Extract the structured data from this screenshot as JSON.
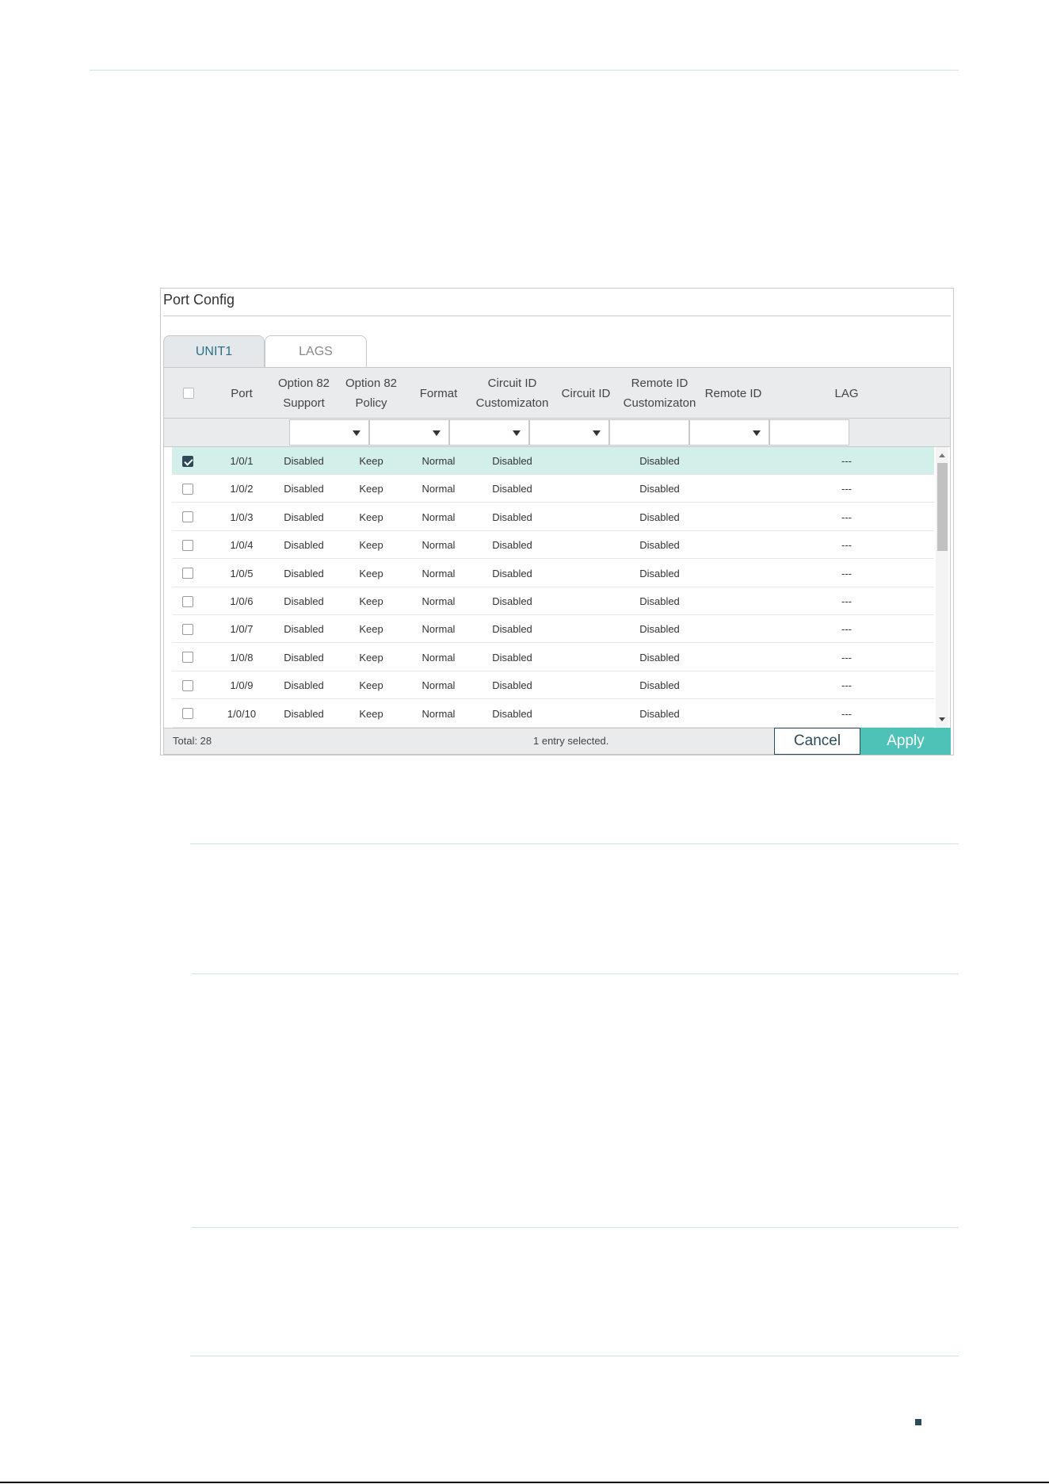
{
  "panel": {
    "title": "Port Config",
    "tabs": [
      {
        "label": "UNIT1",
        "active": true
      },
      {
        "label": "LAGS",
        "active": false
      }
    ]
  },
  "table": {
    "headers": {
      "port": "Port",
      "option82_support": "Option 82\nSupport",
      "option82_policy": "Option 82\nPolicy",
      "format": "Format",
      "circuit_id_custom": "Circuit ID\nCustomizaton",
      "circuit_id": "Circuit ID",
      "remote_id_custom": "Remote ID\nCustomizaton",
      "remote_id": "Remote ID",
      "lag": "LAG"
    },
    "rows": [
      {
        "selected": true,
        "port": "1/0/1",
        "support": "Disabled",
        "policy": "Keep",
        "format": "Normal",
        "circuit_custom": "Disabled",
        "circuit_id": "",
        "remote_custom": "Disabled",
        "remote_id": "",
        "lag": "---"
      },
      {
        "selected": false,
        "port": "1/0/2",
        "support": "Disabled",
        "policy": "Keep",
        "format": "Normal",
        "circuit_custom": "Disabled",
        "circuit_id": "",
        "remote_custom": "Disabled",
        "remote_id": "",
        "lag": "---"
      },
      {
        "selected": false,
        "port": "1/0/3",
        "support": "Disabled",
        "policy": "Keep",
        "format": "Normal",
        "circuit_custom": "Disabled",
        "circuit_id": "",
        "remote_custom": "Disabled",
        "remote_id": "",
        "lag": "---"
      },
      {
        "selected": false,
        "port": "1/0/4",
        "support": "Disabled",
        "policy": "Keep",
        "format": "Normal",
        "circuit_custom": "Disabled",
        "circuit_id": "",
        "remote_custom": "Disabled",
        "remote_id": "",
        "lag": "---"
      },
      {
        "selected": false,
        "port": "1/0/5",
        "support": "Disabled",
        "policy": "Keep",
        "format": "Normal",
        "circuit_custom": "Disabled",
        "circuit_id": "",
        "remote_custom": "Disabled",
        "remote_id": "",
        "lag": "---"
      },
      {
        "selected": false,
        "port": "1/0/6",
        "support": "Disabled",
        "policy": "Keep",
        "format": "Normal",
        "circuit_custom": "Disabled",
        "circuit_id": "",
        "remote_custom": "Disabled",
        "remote_id": "",
        "lag": "---"
      },
      {
        "selected": false,
        "port": "1/0/7",
        "support": "Disabled",
        "policy": "Keep",
        "format": "Normal",
        "circuit_custom": "Disabled",
        "circuit_id": "",
        "remote_custom": "Disabled",
        "remote_id": "",
        "lag": "---"
      },
      {
        "selected": false,
        "port": "1/0/8",
        "support": "Disabled",
        "policy": "Keep",
        "format": "Normal",
        "circuit_custom": "Disabled",
        "circuit_id": "",
        "remote_custom": "Disabled",
        "remote_id": "",
        "lag": "---"
      },
      {
        "selected": false,
        "port": "1/0/9",
        "support": "Disabled",
        "policy": "Keep",
        "format": "Normal",
        "circuit_custom": "Disabled",
        "circuit_id": "",
        "remote_custom": "Disabled",
        "remote_id": "",
        "lag": "---"
      },
      {
        "selected": false,
        "port": "1/0/10",
        "support": "Disabled",
        "policy": "Keep",
        "format": "Normal",
        "circuit_custom": "Disabled",
        "circuit_id": "",
        "remote_custom": "Disabled",
        "remote_id": "",
        "lag": "---"
      }
    ]
  },
  "footer": {
    "total": "Total: 28",
    "selection": "1 entry selected.",
    "cancel_label": "Cancel",
    "apply_label": "Apply"
  },
  "colors": {
    "accent": "#4fc2b8",
    "selected_row": "#d3efea",
    "dark": "#2d4a5a"
  }
}
